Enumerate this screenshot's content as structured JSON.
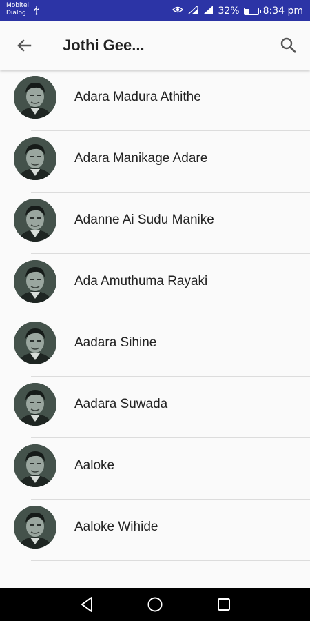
{
  "status_bar": {
    "carrier_line1": "Mobitel",
    "carrier_line2": "Dialog",
    "battery_percent": "32%",
    "battery_level": 0.32,
    "time": "8:34 pm"
  },
  "app_bar": {
    "title": "Jothi Gee...",
    "back_icon": "arrow-back-icon",
    "search_icon": "search-icon"
  },
  "songs": [
    "Adara Madura Athithe",
    "Adara Manikage Adare",
    "Adanne Ai Sudu Manike",
    "Ada Amuthuma Rayaki",
    "Aadara Sihine",
    "Aadara Suwada",
    "Aaloke",
    "Aaloke Wihide"
  ],
  "nav_bar": {
    "back_icon": "triangle-back-icon",
    "home_icon": "circle-home-icon",
    "recents_icon": "square-recents-icon"
  },
  "colors": {
    "status_bar": "#2c34a6",
    "background": "#fafafa",
    "text": "#222222",
    "divider": "#dcdcdc",
    "nav_bar": "#000000"
  }
}
